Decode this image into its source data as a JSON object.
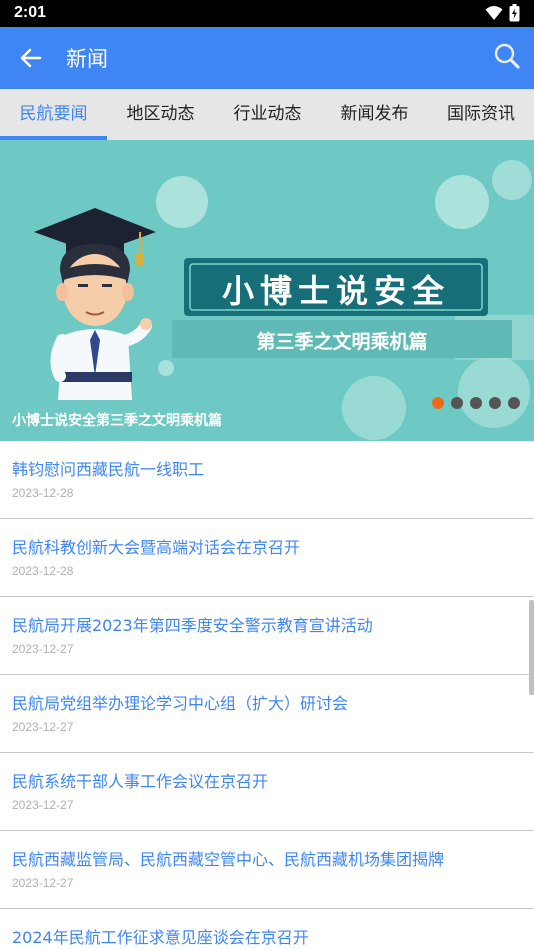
{
  "status_bar": {
    "time": "2:01",
    "icons": [
      "wifi-icon",
      "battery-icon"
    ]
  },
  "app_bar": {
    "title": "新闻",
    "back_icon": "back-arrow-icon",
    "search_icon": "search-icon"
  },
  "tabs": [
    {
      "label": "民航要闻",
      "active": true
    },
    {
      "label": "地区动态",
      "active": false
    },
    {
      "label": "行业动态",
      "active": false
    },
    {
      "label": "新闻发布",
      "active": false
    },
    {
      "label": "国际资讯",
      "active": false
    }
  ],
  "banner": {
    "headline": "小博士说安全",
    "subheadline": "第三季之文明乘机篇",
    "caption": "小博士说安全第三季之文明乘机篇",
    "slide_count": 5,
    "active_slide": 1,
    "colors": {
      "background": "#6ec8c3",
      "active_dot": "#ee6a1b",
      "dot": "#555555"
    }
  },
  "news": [
    {
      "title": "韩钧慰问西藏民航一线职工",
      "date": "2023-12-28"
    },
    {
      "title": "民航科教创新大会暨高端对话会在京召开",
      "date": "2023-12-28"
    },
    {
      "title": "民航局开展2023年第四季度安全警示教育宣讲活动",
      "date": "2023-12-27"
    },
    {
      "title": "民航局党组举办理论学习中心组（扩大）研讨会",
      "date": "2023-12-27"
    },
    {
      "title": "民航系统干部人事工作会议在京召开",
      "date": "2023-12-27"
    },
    {
      "title": "民航西藏监管局、民航西藏空管中心、民航西藏机场集团揭牌",
      "date": "2023-12-27"
    },
    {
      "title": "2024年民航工作征求意见座谈会在京召开",
      "date": ""
    }
  ],
  "colors": {
    "accent": "#3f86f4",
    "tab_bar": "#e6e6e6"
  }
}
